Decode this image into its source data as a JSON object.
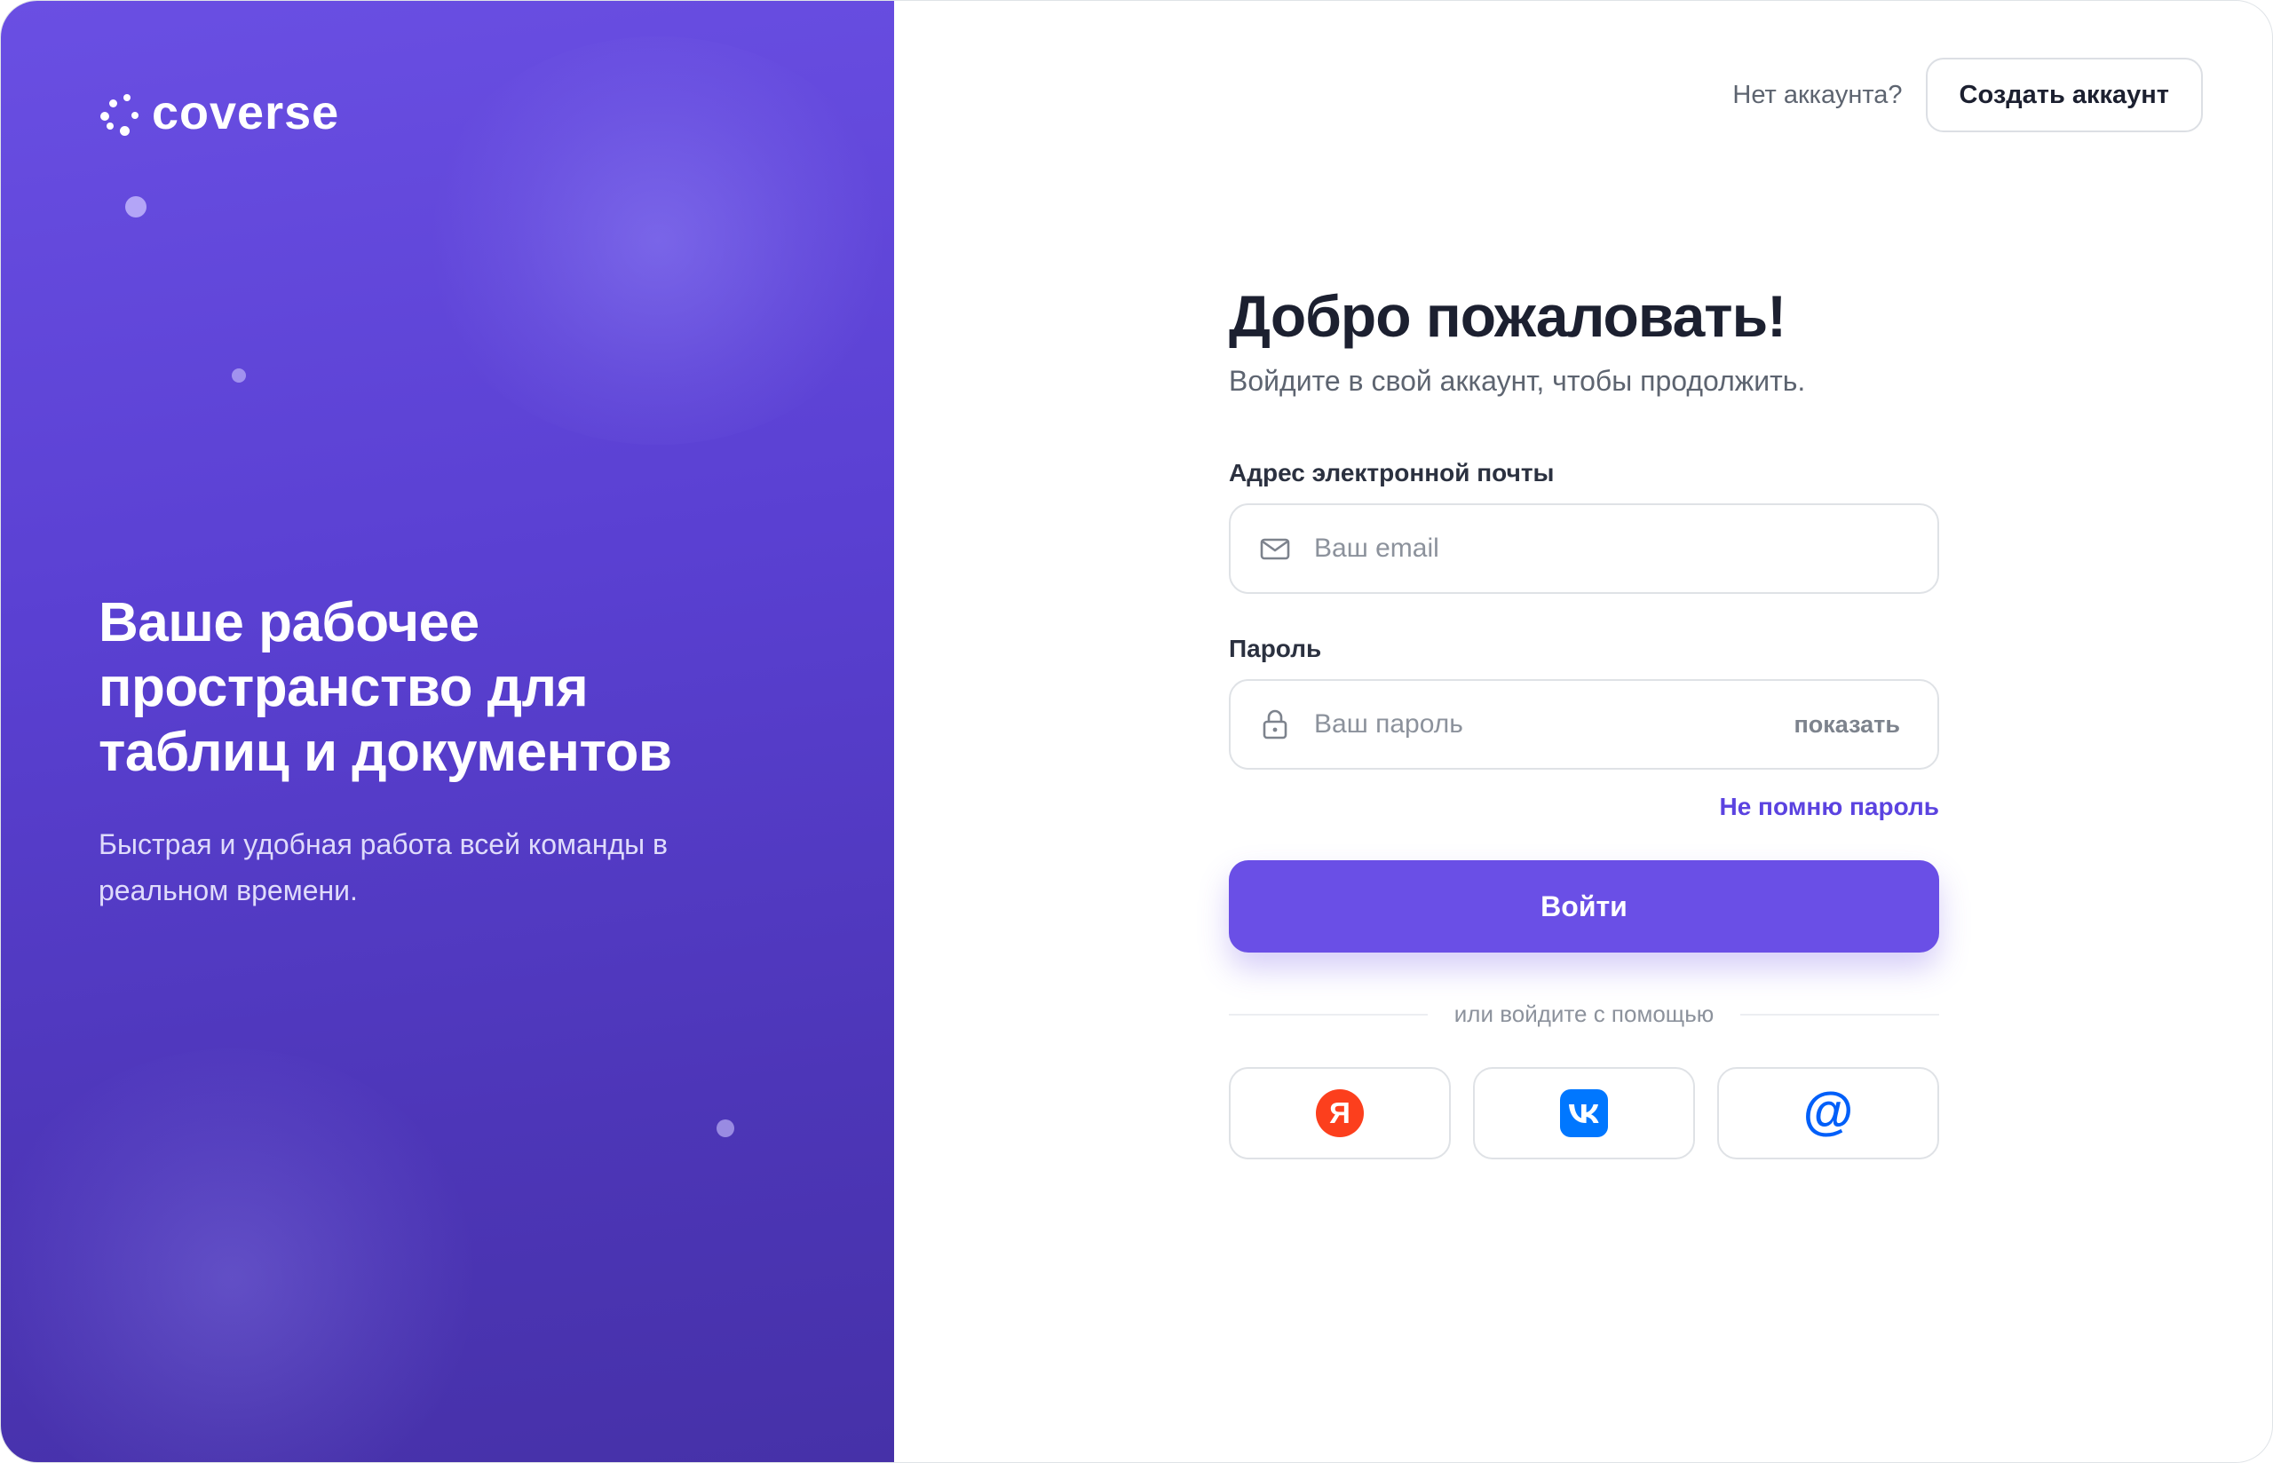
{
  "brand": {
    "name": "coverse",
    "accent": "#6a4fe6",
    "panel_color": "#5a40d2"
  },
  "promo": {
    "title": "Ваше рабочее пространство для таблиц и документов",
    "subtitle": "Быстрая и удобная работа всей команды в реальном времени."
  },
  "header": {
    "no_account": "Нет аккаунта?",
    "create_account": "Создать аккаунт"
  },
  "form": {
    "title": "Добро пожаловать!",
    "subtitle": "Войдите в свой аккаунт, чтобы продолжить.",
    "email_label": "Адрес электронной почты",
    "email_placeholder": "Ваш email",
    "email_icon": "mail-icon",
    "password_label": "Пароль",
    "password_placeholder": "Ваш пароль",
    "password_icon": "lock-icon",
    "show_password": "показать",
    "forgot_password": "Не помню пароль",
    "submit": "Войти",
    "divider": "или войдите с помощью"
  },
  "socials": [
    {
      "name": "yandex-icon",
      "glyph": "Я",
      "color": "#fc3f1d"
    },
    {
      "name": "vk-icon",
      "glyph": "VK",
      "color": "#0077ff"
    },
    {
      "name": "mail-ru-icon",
      "glyph": "@",
      "color": "#005ff9"
    }
  ]
}
